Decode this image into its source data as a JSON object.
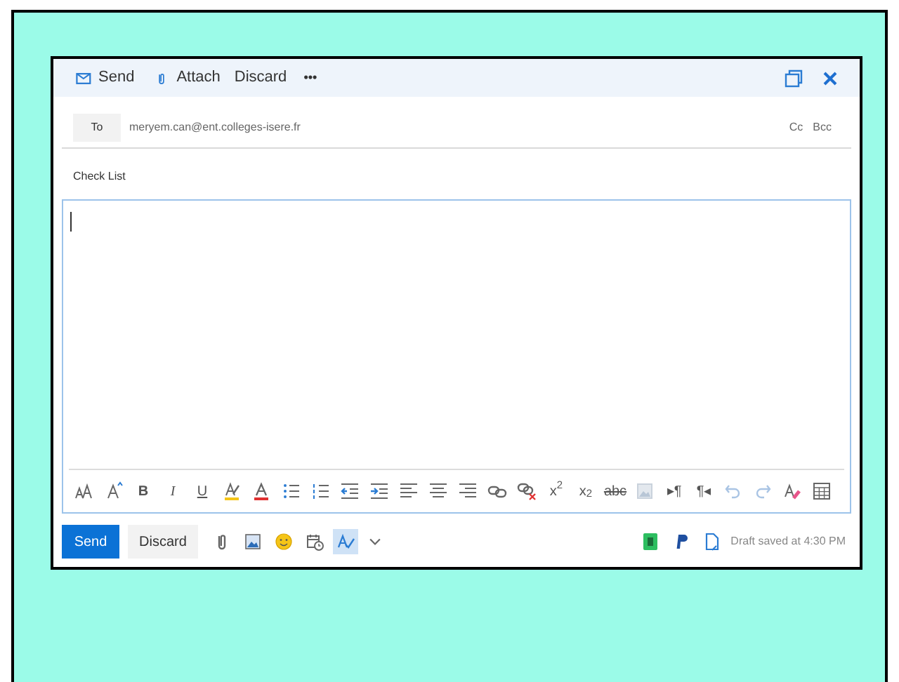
{
  "toolbar": {
    "send": "Send",
    "attach": "Attach",
    "discard": "Discard",
    "more": "•••"
  },
  "to": {
    "label": "To",
    "value": "meryem.can@ent.colleges-isere.fr"
  },
  "cc": "Cc",
  "bcc": "Bcc",
  "subject": "Check List",
  "format_texts": [
    "B",
    "I",
    "U",
    "x$^{2}$",
    "x$_{2}$",
    "abc",
    "▸¶",
    "¶◂"
  ],
  "bottom": {
    "send": "Send",
    "discard": "Discard",
    "spell_check": {
      "selected": true
    },
    "status": "Draft saved at 4:30 PM"
  }
}
